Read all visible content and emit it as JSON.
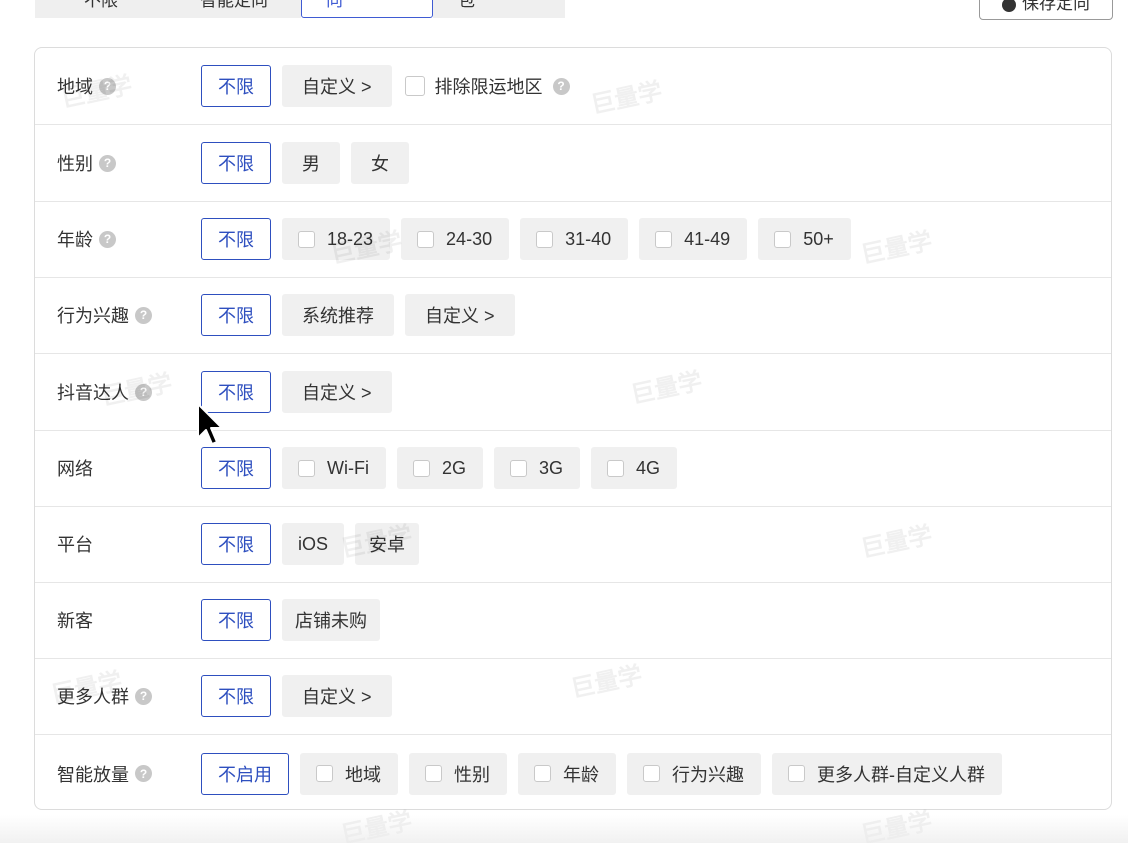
{
  "top_tabs": {
    "tab1": "不限",
    "tab2": "智能定向",
    "tab3": "自定义定向",
    "tab4": "已有定向包"
  },
  "save_button": "保存定向",
  "rows": {
    "region": {
      "label": "地域",
      "unlimited": "不限",
      "custom": "自定义 >",
      "exclude": "排除限运地区"
    },
    "gender": {
      "label": "性别",
      "unlimited": "不限",
      "male": "男",
      "female": "女"
    },
    "age": {
      "label": "年龄",
      "unlimited": "不限",
      "options": [
        "18-23",
        "24-30",
        "31-40",
        "41-49",
        "50+"
      ]
    },
    "interest": {
      "label": "行为兴趣",
      "unlimited": "不限",
      "recommend": "系统推荐",
      "custom": "自定义 >"
    },
    "douyin": {
      "label": "抖音达人",
      "unlimited": "不限",
      "custom": "自定义 >"
    },
    "network": {
      "label": "网络",
      "unlimited": "不限",
      "options": [
        "Wi-Fi",
        "2G",
        "3G",
        "4G"
      ]
    },
    "platform": {
      "label": "平台",
      "unlimited": "不限",
      "ios": "iOS",
      "android": "安卓"
    },
    "new_customer": {
      "label": "新客",
      "unlimited": "不限",
      "not_purchased": "店铺未购"
    },
    "more_people": {
      "label": "更多人群",
      "unlimited": "不限",
      "custom": "自定义 >"
    },
    "smart": {
      "label": "智能放量",
      "disabled": "不启用",
      "options": [
        "地域",
        "性别",
        "年龄",
        "行为兴趣",
        "更多人群-自定义人群"
      ]
    }
  },
  "watermark": "巨量学",
  "colors": {
    "accent": "#2e4fbf",
    "option_bg": "#f0f0f0",
    "border": "#dcdcdc"
  }
}
